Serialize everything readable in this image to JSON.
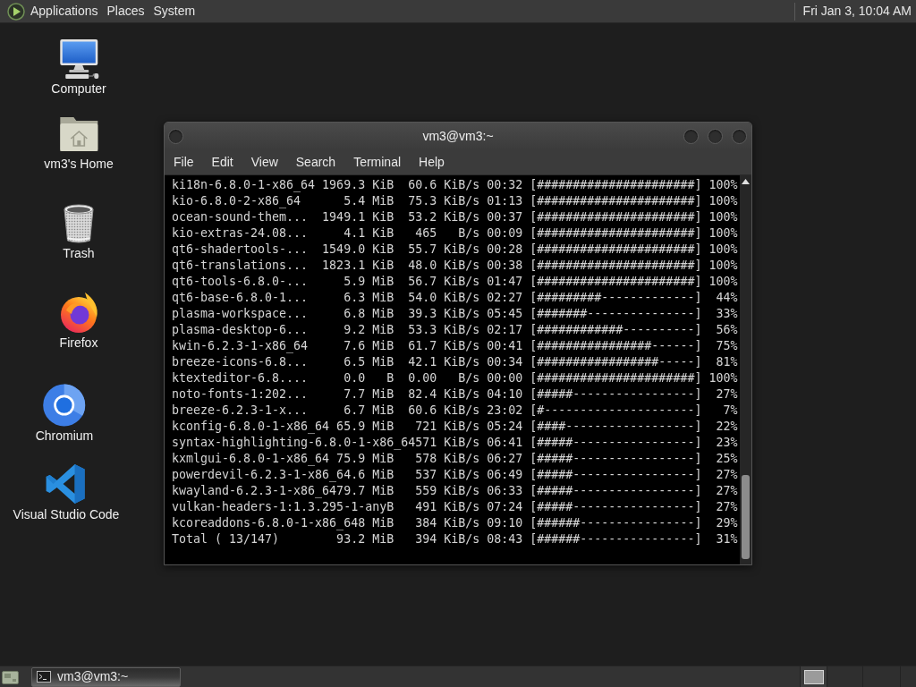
{
  "top_panel": {
    "menus": [
      "Applications",
      "Places",
      "System"
    ],
    "clock": "Fri Jan 3, 10:04 AM"
  },
  "desktop_icons": [
    {
      "kind": "computer",
      "label": "Computer"
    },
    {
      "kind": "home",
      "label": "vm3's Home"
    },
    {
      "kind": "trash",
      "label": "Trash"
    },
    {
      "kind": "firefox",
      "label": "Firefox"
    },
    {
      "kind": "chromium",
      "label": "Chromium"
    },
    {
      "kind": "vscode",
      "label": "Visual Studio Code"
    }
  ],
  "terminal": {
    "title": "vm3@vm3:~",
    "menu": [
      "File",
      "Edit",
      "View",
      "Search",
      "Terminal",
      "Help"
    ],
    "lines": [
      "ki18n-6.8.0-1-x86_64 1969.3 KiB  60.6 KiB/s 00:32 [######################] 100%",
      "kio-6.8.0-2-x86_64      5.4 MiB  75.3 KiB/s 01:13 [######################] 100%",
      "ocean-sound-them...  1949.1 KiB  53.2 KiB/s 00:37 [######################] 100%",
      "kio-extras-24.08...     4.1 KiB   465   B/s 00:09 [######################] 100%",
      "qt6-shadertools-...  1549.0 KiB  55.7 KiB/s 00:28 [######################] 100%",
      "qt6-translations...  1823.1 KiB  48.0 KiB/s 00:38 [######################] 100%",
      "qt6-tools-6.8.0-...     5.9 MiB  56.7 KiB/s 01:47 [######################] 100%",
      "qt6-base-6.8.0-1...     6.3 MiB  54.0 KiB/s 02:27 [#########-------------]  44%",
      "plasma-workspace...     6.8 MiB  39.3 KiB/s 05:45 [#######---------------]  33%",
      "plasma-desktop-6...     9.2 MiB  53.3 KiB/s 02:17 [############----------]  56%",
      "kwin-6.2.3-1-x86_64     7.6 MiB  61.7 KiB/s 00:41 [################------]  75%",
      "breeze-icons-6.8...     6.5 MiB  42.1 KiB/s 00:34 [#################-----]  81%",
      "ktexteditor-6.8....     0.0   B  0.00   B/s 00:00 [######################] 100%",
      "noto-fonts-1:202...     7.7 MiB  82.4 KiB/s 04:10 [#####-----------------]  27%",
      "breeze-6.2.3-1-x...     6.7 MiB  60.6 KiB/s 23:02 [#---------------------]   7%",
      "kconfig-6.8.0-1-x86_64 65.9 MiB   721 KiB/s 05:24 [####------------------]  22%",
      "syntax-highlighting-6.8.0-1-x86_64571 KiB/s 06:41 [#####-----------------]  23%",
      "kxmlgui-6.8.0-1-x86_64 75.9 MiB   578 KiB/s 06:27 [#####-----------------]  25%",
      "powerdevil-6.2.3-1-x86_64.6 MiB   537 KiB/s 06:49 [#####-----------------]  27%",
      "kwayland-6.2.3-1-x86_6479.7 MiB   559 KiB/s 06:33 [#####-----------------]  27%",
      "vulkan-headers-1:1.3.295-1-anyB   491 KiB/s 07:24 [#####-----------------]  27%",
      "kcoreaddons-6.8.0-1-x86_648 MiB   384 KiB/s 09:10 [######----------------]  29%",
      "Total ( 13/147)        93.2 MiB   394 KiB/s 08:43 [######----------------]  31%"
    ]
  },
  "taskbar": {
    "tasks": [
      {
        "label": "vm3@vm3:~",
        "selected": true
      }
    ]
  }
}
